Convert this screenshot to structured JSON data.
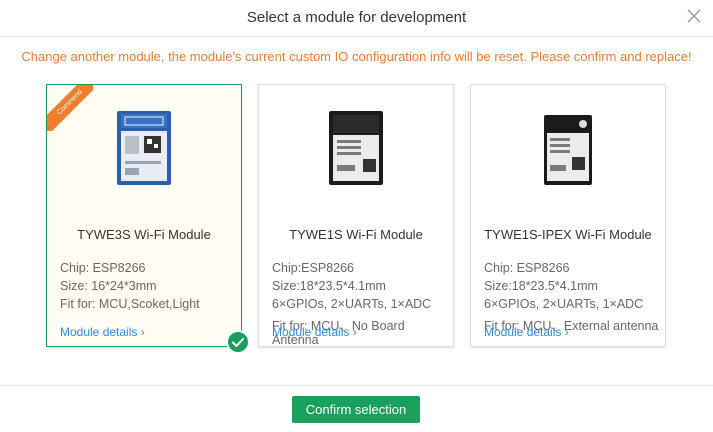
{
  "dialog": {
    "title": "Select a module for development",
    "warning": "Change another module, the module's current custom IO configuration info will be reset. Please confirm and replace!"
  },
  "modules": [
    {
      "ribbon": "Commend",
      "name": "TYWE3S Wi-Fi Module",
      "chip": "Chip: ESP8266",
      "size": "Size: 16*24*3mm",
      "io": "",
      "fit": "Fit for: MCU,Scoket,Light",
      "fit2": "",
      "details": "Module details ›",
      "selected": true
    },
    {
      "ribbon": "",
      "name": "TYWE1S Wi-Fi Module",
      "chip": "Chip:ESP8266",
      "size": "Size:18*23.5*4.1mm",
      "io": "6×GPIOs, 2×UARTs, 1×ADC",
      "fit": "Fit for: MCU、No Board",
      "fit2": "Antenna",
      "details": "Module details ›",
      "selected": false
    },
    {
      "ribbon": "",
      "name": "TYWE1S-IPEX Wi-Fi Module",
      "chip": "Chip: ESP8266",
      "size": "Size:18*23.5*4.1mm",
      "io": "6×GPIOs, 2×UARTs, 1×ADC",
      "fit": "Fit for: MCU、External antenna",
      "fit2": "",
      "details": "Module details ›",
      "selected": false
    }
  ],
  "footer": {
    "confirm_label": "Confirm selection"
  },
  "icons": {
    "close": "close-icon",
    "check": "check-icon",
    "chevron": "chevron-right"
  },
  "colors": {
    "accent": "#1aa05c",
    "warning": "#f07c2e",
    "link": "#2a8ce0"
  }
}
